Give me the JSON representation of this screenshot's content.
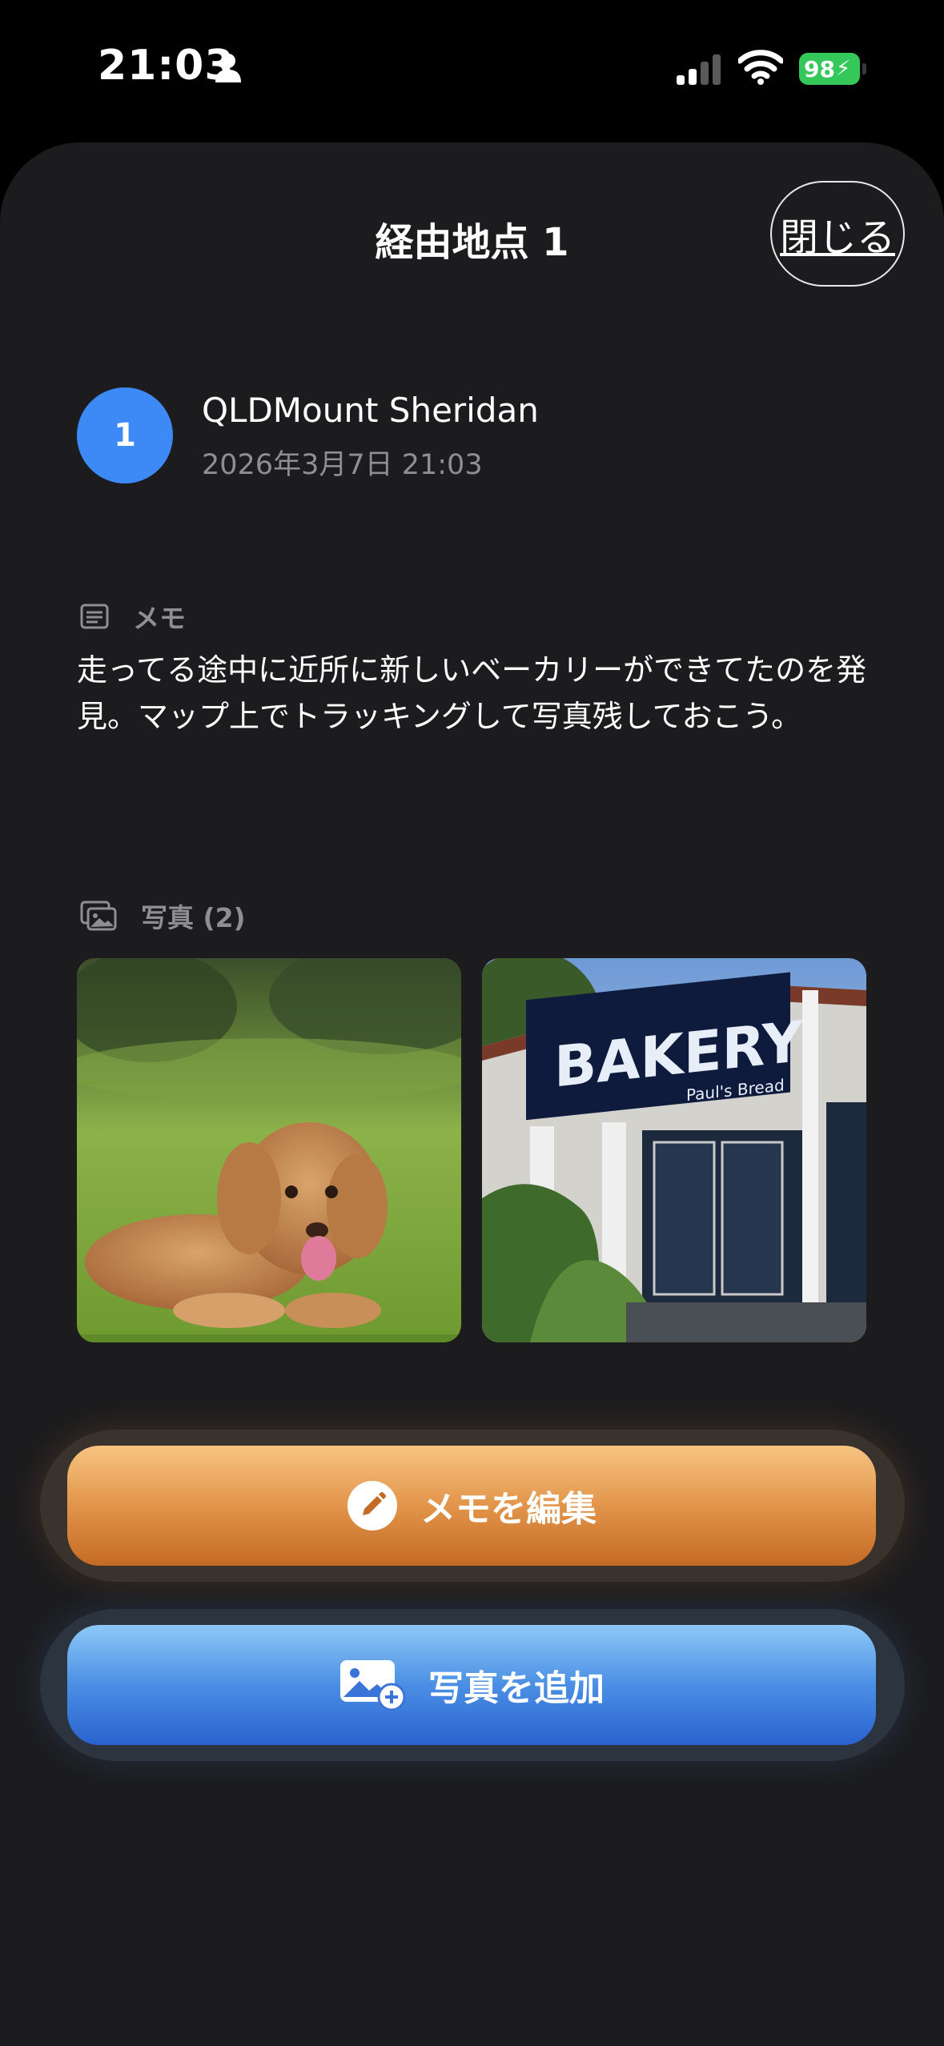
{
  "status_bar": {
    "time": "21:03",
    "battery": "98",
    "icons": [
      "person-icon",
      "signal-icon",
      "wifi-icon",
      "battery-charging-icon"
    ]
  },
  "sheet": {
    "title": "経由地点 1",
    "close_label": "閉じる"
  },
  "waypoint": {
    "number": "1",
    "name": "QLDMount Sheridan",
    "datetime": "2026年3月7日 21:03",
    "badge_color": "#3d8af7"
  },
  "memo": {
    "label": "メモ",
    "text": "走ってる途中に近所に新しいベーカリーができてたのを発見。マップ上でトラッキングして写真残しておこう。",
    "icon": "note-icon"
  },
  "photos": {
    "label": "写真 (2)",
    "icon": "photo-stack-icon",
    "items": [
      {
        "name": "dog-photo"
      },
      {
        "name": "bakery-photo",
        "sign_text": "BAKERY",
        "sign_subtext": "Paul's Bread"
      }
    ]
  },
  "actions": {
    "edit_memo": {
      "label": "メモを編集",
      "icon": "pencil-icon",
      "color": "#e2954a"
    },
    "add_photo": {
      "label": "写真を追加",
      "icon": "add-photo-icon",
      "color": "#4a8fe4"
    }
  }
}
